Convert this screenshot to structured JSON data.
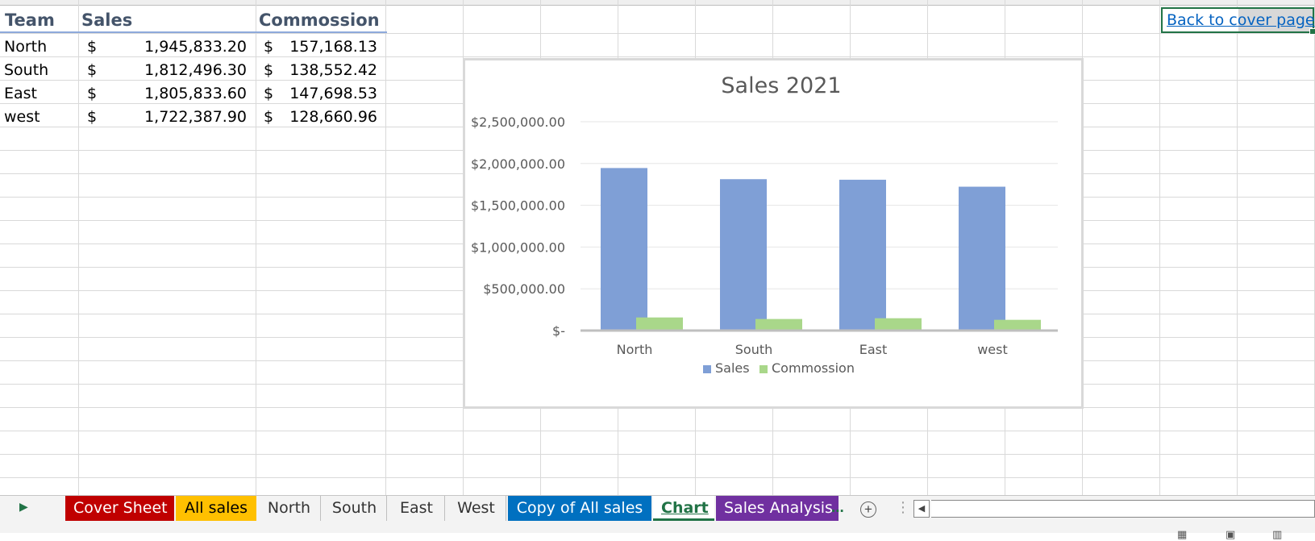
{
  "table": {
    "headers": [
      "Team",
      "Sales",
      "Commossion"
    ],
    "rows": [
      {
        "team": "North",
        "sales_cur": "$",
        "sales": "1,945,833.20",
        "comm_cur": "$",
        "comm": "157,168.13"
      },
      {
        "team": "South",
        "sales_cur": "$",
        "sales": "1,812,496.30",
        "comm_cur": "$",
        "comm": "138,552.42"
      },
      {
        "team": "East",
        "sales_cur": "$",
        "sales": "1,805,833.60",
        "comm_cur": "$",
        "comm": "147,698.53"
      },
      {
        "team": "west",
        "sales_cur": "$",
        "sales": "1,722,387.90",
        "comm_cur": "$",
        "comm": "128,660.96"
      }
    ]
  },
  "link": {
    "label": "Back to cover page"
  },
  "chart_data": {
    "type": "bar",
    "title": "Sales 2021",
    "categories": [
      "North",
      "South",
      "East",
      "west"
    ],
    "series": [
      {
        "name": "Sales",
        "values": [
          1945833.2,
          1812496.3,
          1805833.6,
          1722387.9
        ],
        "color": "#7f9fd6"
      },
      {
        "name": "Commossion",
        "values": [
          157168.13,
          138552.42,
          147698.53,
          128660.96
        ],
        "color": "#a9d78a"
      }
    ],
    "y_ticks": [
      0,
      500000,
      1000000,
      1500000,
      2000000,
      2500000
    ],
    "y_tick_labels": [
      "$-",
      "$500,000.00",
      "$1,000,000.00",
      "$1,500,000.00",
      "$2,000,000.00",
      "$2,500,000.00"
    ],
    "ylim": [
      0,
      2500000
    ],
    "legend": "bottom",
    "grid": true,
    "xlabel": "",
    "ylabel": ""
  },
  "legend_labels": {
    "sales": "Sales",
    "commission": "Commossion"
  },
  "tabs": [
    {
      "label": "Cover Sheet",
      "bg": "#c00000",
      "fg": "#ffffff"
    },
    {
      "label": "All sales",
      "bg": "#ffc000",
      "fg": "#000000"
    },
    {
      "label": "North",
      "bg": "",
      "fg": "#333333"
    },
    {
      "label": "South",
      "bg": "",
      "fg": "#333333"
    },
    {
      "label": "East",
      "bg": "",
      "fg": "#333333"
    },
    {
      "label": "West",
      "bg": "",
      "fg": "#333333"
    },
    {
      "label": "Copy of All sales",
      "bg": "#0070c0",
      "fg": "#ffffff"
    },
    {
      "label": "Chart",
      "bg": "#ffffff",
      "fg": "#217346",
      "active": true
    },
    {
      "label": "Sales Analysis",
      "bg": "#7030a0",
      "fg": "#ffffff"
    }
  ],
  "tab_controls": {
    "more": "...",
    "add": "+",
    "vdots": "⋮"
  },
  "icons": {
    "nav": "play-arrow-icon",
    "add": "plus-circle-icon",
    "scroll": "scroll-left-icon"
  },
  "colors": {
    "accent": "#217346",
    "link": "#0563c1",
    "header_text": "#44546a"
  }
}
